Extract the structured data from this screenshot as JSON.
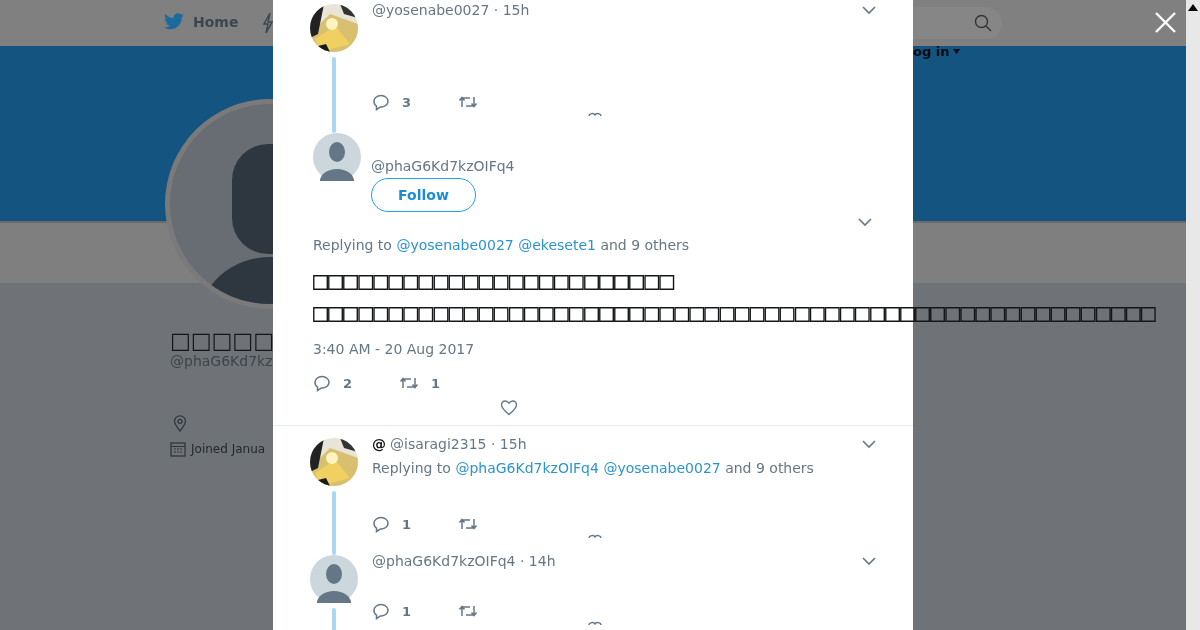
{
  "background": {
    "nav": {
      "home": "Home",
      "login": "og in"
    },
    "profile": {
      "name": "□□□□□",
      "handle": "@phaG6Kd7kz",
      "joined": "Joined Janua"
    }
  },
  "modal": {
    "tweets": [
      {
        "kind": "thread",
        "avatar_photo": true,
        "meta": "@yosenabe0027 · 15h",
        "replies": "3",
        "thread_line": true
      },
      {
        "kind": "focused",
        "avatar_photo": false,
        "handle": "@phaG6Kd7kzOIFq4",
        "follow": "Follow",
        "replying": "Replying to",
        "mentions": [
          "@yosenabe0027",
          "@ekesete1"
        ],
        "others": "and 9 others",
        "lines": [
          "□□□□□□□□□□□□□□□□□□□□□□□□",
          "□□□□□□□□□□□□□□□□□□□□□□□□□□□□□□□□□□□□□□□□□□□□□□□□□□□□□□□□"
        ],
        "time": "3:40 AM - 20 Aug 2017",
        "replies": "2",
        "retweets": "1"
      },
      {
        "kind": "thread",
        "avatar_photo": true,
        "at": "@",
        "meta": "@isaragi2315 · 15h",
        "replying": "Replying to",
        "mentions": [
          "@phaG6Kd7kzOIFq4",
          "@yosenabe0027"
        ],
        "others": "and 9 others",
        "replies": "1",
        "thread_line": true
      },
      {
        "kind": "thread",
        "avatar_photo": false,
        "meta": "@phaG6Kd7kzOIFq4 · 14h",
        "replies": "1",
        "thread_line": true
      }
    ]
  }
}
